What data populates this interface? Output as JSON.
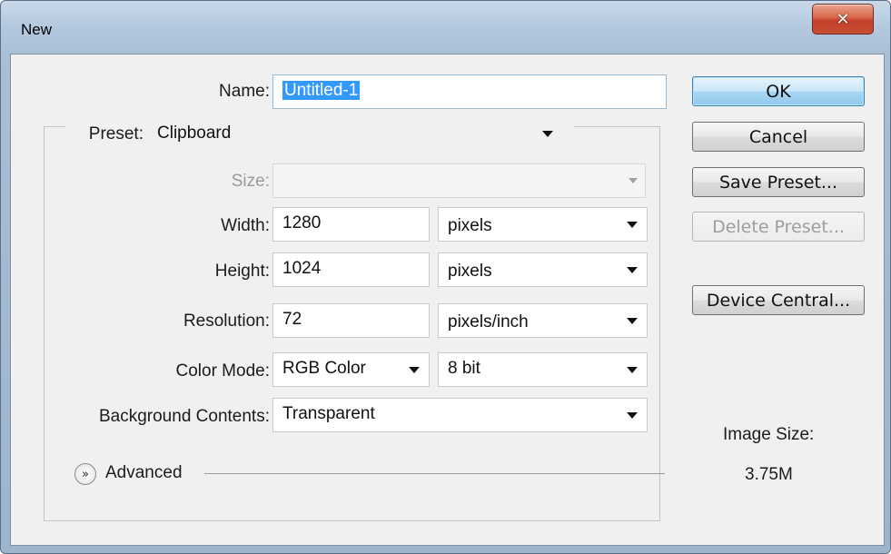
{
  "window": {
    "title": "New",
    "close_glyph": "✕"
  },
  "form": {
    "name_label": "Name:",
    "name_value": "Untitled-1",
    "preset_label": "Preset:",
    "preset_value": "Clipboard",
    "size_label": "Size:",
    "size_value": "",
    "width_label": "Width:",
    "width_value": "1280",
    "width_unit": "pixels",
    "height_label": "Height:",
    "height_value": "1024",
    "height_unit": "pixels",
    "resolution_label": "Resolution:",
    "resolution_value": "72",
    "resolution_unit": "pixels/inch",
    "color_mode_label": "Color Mode:",
    "color_mode_value": "RGB Color",
    "bit_depth_value": "8 bit",
    "background_label": "Background Contents:",
    "background_value": "Transparent",
    "advanced_label": "Advanced"
  },
  "buttons": {
    "ok": "OK",
    "cancel": "Cancel",
    "save_preset": "Save Preset...",
    "delete_preset": "Delete Preset...",
    "device_central": "Device Central..."
  },
  "image_size": {
    "label": "Image Size:",
    "value": "3.75M"
  },
  "icons": {
    "close": "close-icon",
    "dropdown": "chevron-down-icon",
    "advanced": "double-chevron-down-icon"
  },
  "colors": {
    "title_gradient_top": "#c9d9ea",
    "close_button": "#c94f33",
    "selection": "#3399ff",
    "default_button": "#a8d6f3"
  }
}
